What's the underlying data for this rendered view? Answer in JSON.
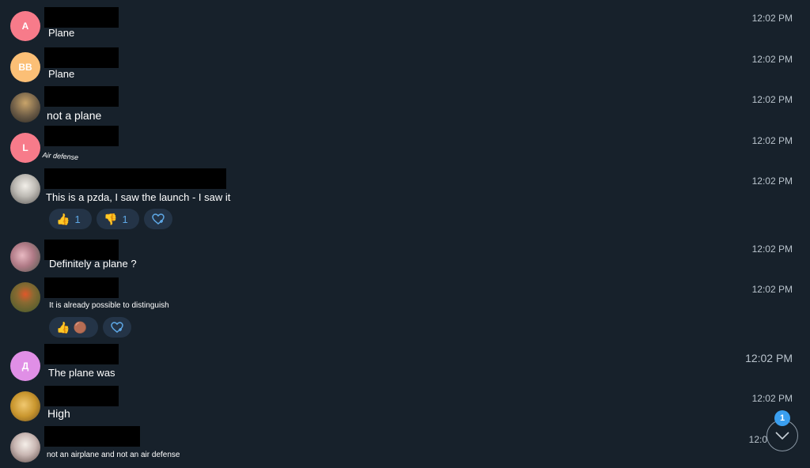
{
  "messages": [
    {
      "avatar_initials": "A",
      "avatar_color": "#f77b8a",
      "text": "Plane",
      "time": "12:02 PM"
    },
    {
      "avatar_initials": "BB",
      "avatar_color": "#fbbf76",
      "text": "Plane",
      "time": "12:02 PM"
    },
    {
      "avatar_initials": "",
      "avatar_color": "#6a5a45",
      "text": "not a plane",
      "time": "12:02 PM"
    },
    {
      "avatar_initials": "L",
      "avatar_color": "#f77b8a",
      "text": "Air defense",
      "time": "12:02 PM"
    },
    {
      "avatar_initials": "",
      "avatar_color": "#d8d8d8",
      "text": "This is a pzda, I saw the launch - I saw it",
      "time": "12:02 PM",
      "reactions": [
        {
          "emoji": "👍",
          "count": "1"
        },
        {
          "emoji": "👎",
          "count": "1"
        }
      ]
    },
    {
      "avatar_initials": "",
      "avatar_color": "#b07a86",
      "text": "Definitely a plane ?",
      "time": "12:02 PM"
    },
    {
      "avatar_initials": "",
      "avatar_color": "#5a7a3e",
      "text": "It is already possible to distinguish",
      "time": "12:02 PM",
      "reactions": [
        {
          "emoji": "👍",
          "count": ""
        },
        {
          "emoji": "🟤",
          "count": ""
        }
      ]
    },
    {
      "avatar_initials": "Д",
      "avatar_color": "#e08fe6",
      "text": "The plane was",
      "time": "12:02 PM"
    },
    {
      "avatar_initials": "",
      "avatar_color": "#c9962e",
      "text": "High",
      "time": "12:02 PM"
    },
    {
      "avatar_initials": "",
      "avatar_color": "#c9b7b3",
      "text": "not an airplane and not an air defense",
      "time": "12:0"
    }
  ],
  "scroll_down": {
    "badge_count": "1"
  },
  "colors": {
    "background": "#17212b",
    "accent": "#3a9ff0",
    "reaction_bg": "#243447"
  }
}
